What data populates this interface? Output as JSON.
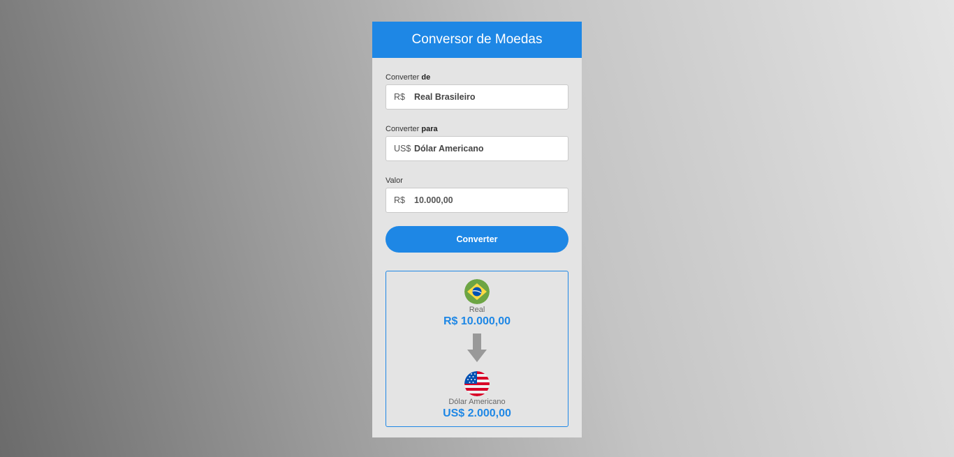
{
  "header": {
    "title": "Conversor de Moedas"
  },
  "form": {
    "from": {
      "label_prefix": "Converter ",
      "label_bold": "de",
      "symbol": "R$",
      "value": "Real Brasileiro"
    },
    "to": {
      "label_prefix": "Converter ",
      "label_bold": "para",
      "symbol": "US$",
      "value": "Dólar Americano"
    },
    "amount": {
      "label": "Valor",
      "symbol": "R$",
      "value": "10.000,00"
    },
    "button_label": "Converter"
  },
  "result": {
    "source": {
      "flag_icon": "brazil-flag-icon",
      "name": "Real",
      "amount": "R$ 10.000,00"
    },
    "target": {
      "flag_icon": "usa-flag-icon",
      "name": "Dólar Americano",
      "amount": "US$ 2.000,00"
    },
    "arrow_icon": "arrow-down-icon"
  },
  "colors": {
    "accent": "#1e87e5",
    "card_bg": "#e4e4e4",
    "arrow": "#999999"
  }
}
